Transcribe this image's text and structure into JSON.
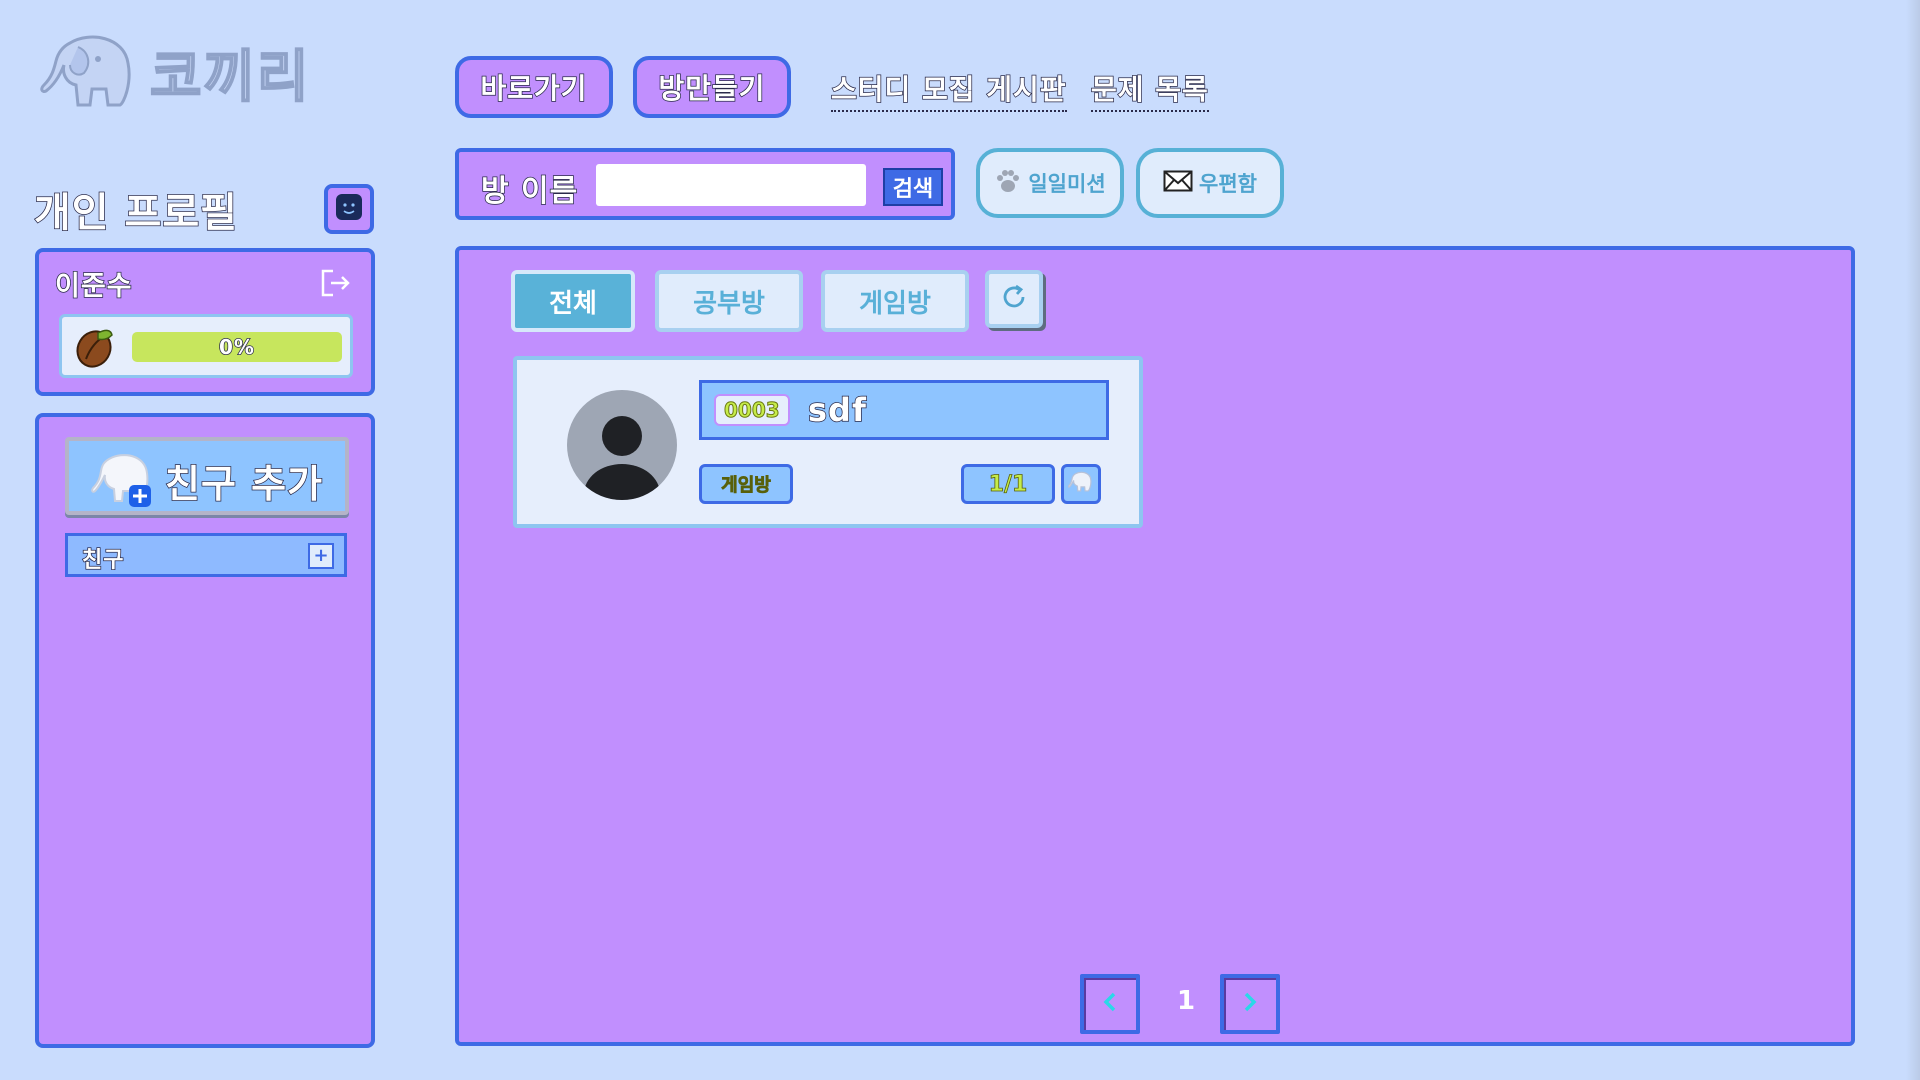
{
  "app": {
    "logo_text": "코끼리"
  },
  "nav": {
    "shortcut": "바로가기",
    "create_room": "방만들기",
    "study_board": "스터디 모집 게시판",
    "problem_list": "문제 목록"
  },
  "search": {
    "label": "방 이름",
    "value": "",
    "button": "검색"
  },
  "buttons": {
    "daily_mission": "일일미션",
    "mailbox": "우편함"
  },
  "profile": {
    "title": "개인 프로필",
    "name": "이준수",
    "progress_text": "0%",
    "progress_fraction": 0
  },
  "friends": {
    "add_label": "친구 추가",
    "group_label": "친구",
    "group_add": "+"
  },
  "filters": [
    {
      "label": "전체",
      "active": true
    },
    {
      "label": "공부방",
      "active": false
    },
    {
      "label": "게임방",
      "active": false
    }
  ],
  "rooms": [
    {
      "id": "0003",
      "title": "sdf",
      "type": "게임방",
      "count": "1/1"
    }
  ],
  "pagination": {
    "current": "1"
  },
  "colors": {
    "background": "#c9dcfd",
    "panel": "#c18ffe",
    "border": "#3e6ae5",
    "accent_teal": "#59b2d8",
    "progress": "#a4c400"
  }
}
